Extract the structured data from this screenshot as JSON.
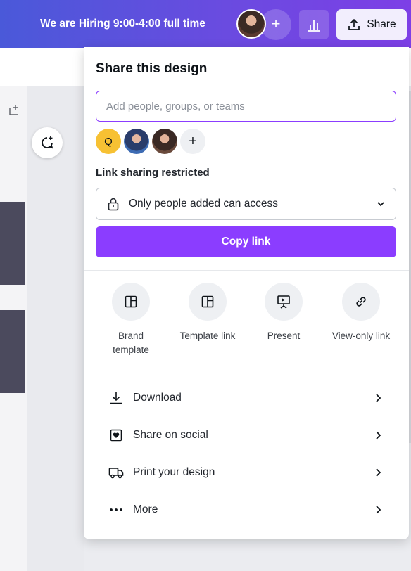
{
  "topbar": {
    "hiring_text": "We are Hiring 9:00-4:00 full time",
    "plus_label": "+",
    "share_label": "Share"
  },
  "share_panel": {
    "title": "Share this design",
    "people_input": {
      "value": "",
      "placeholder": "Add people, groups, or teams"
    },
    "people": [
      {
        "initial": "Q"
      },
      {
        "initial": ""
      },
      {
        "initial": ""
      }
    ],
    "add_person_label": "+",
    "link_sharing_label": "Link sharing restricted",
    "access_select": {
      "value": "Only people added can access"
    },
    "copy_link_label": "Copy link",
    "options": [
      {
        "label": "Brand template",
        "icon": "template-icon"
      },
      {
        "label": "Template link",
        "icon": "template-icon"
      },
      {
        "label": "Present",
        "icon": "present-icon"
      },
      {
        "label": "View-only link",
        "icon": "link-icon"
      }
    ],
    "menu": [
      {
        "label": "Download",
        "icon": "download-icon"
      },
      {
        "label": "Share on social",
        "icon": "heart-icon"
      },
      {
        "label": "Print your design",
        "icon": "truck-icon"
      },
      {
        "label": "More",
        "icon": "more-icon"
      }
    ]
  },
  "colors": {
    "accent": "#8b3dff",
    "topbar_start": "#4a59d9",
    "topbar_end": "#7d3fe6"
  }
}
